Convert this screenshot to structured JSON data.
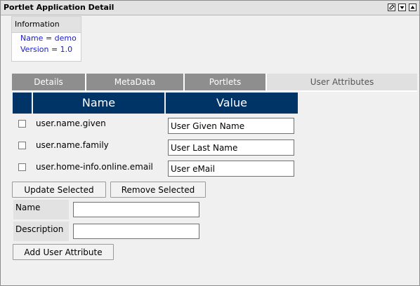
{
  "portlet": {
    "title": "Portlet Application Detail"
  },
  "window_buttons": [
    {
      "name": "edit-icon"
    },
    {
      "name": "minimize-icon"
    },
    {
      "name": "maximize-icon"
    }
  ],
  "info": {
    "header": "Information",
    "name_line": "Name = demo",
    "version_line": "Version = 1.0"
  },
  "tabs": [
    {
      "label": "Details",
      "active": false
    },
    {
      "label": "MetaData",
      "active": false
    },
    {
      "label": "Portlets",
      "active": false
    },
    {
      "label": "User Attributes",
      "active": true
    }
  ],
  "grid": {
    "headers": [
      "",
      "Name",
      "Value"
    ],
    "rows": [
      {
        "name": "user.name.given",
        "value": "User Given Name",
        "checked": false
      },
      {
        "name": "user.name.family",
        "value": "User Last Name",
        "checked": false
      },
      {
        "name": "user.home-info.online.email",
        "value": "User eMail",
        "checked": false
      }
    ]
  },
  "actions": {
    "update_label": "Update Selected",
    "remove_label": "Remove Selected"
  },
  "new_attribute": {
    "name_label": "Name",
    "name_value": "",
    "description_label": "Description",
    "description_value": "",
    "add_label": "Add User Attribute"
  },
  "colors": {
    "header_bg": "#003366",
    "tab_inactive": "#8e8e8e",
    "info_text": "#1a1acc"
  }
}
